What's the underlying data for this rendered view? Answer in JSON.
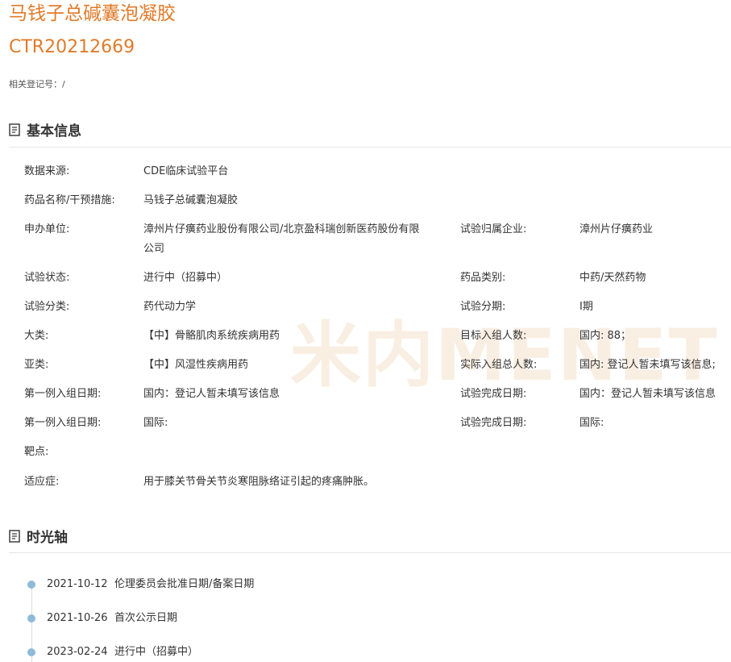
{
  "header": {
    "title": "马钱子总碱囊泡凝胶",
    "code": "CTR20212669",
    "related": "相关登记号：/"
  },
  "sections": {
    "basic": "基本信息",
    "timeline": "时光轴"
  },
  "watermark": "米内MENET",
  "info": {
    "source_label": "数据来源:",
    "source_value": "CDE临床试验平台",
    "drug_label": "药品名称/干预措施:",
    "drug_value": "马钱子总碱囊泡凝胶",
    "sponsor_label": "申办单位:",
    "sponsor_value": "漳州片仔癀药业股份有限公司/北京盈科瑞创新医药股份有限公司",
    "company_label": "试验归属企业:",
    "company_value": "漳州片仔癀药业",
    "status_label": "试验状态:",
    "status_value": "进行中（招募中）",
    "category_label": "药品类别:",
    "category_value": "中药/天然药物",
    "trial_type_label": "试验分类:",
    "trial_type_value": "药代动力学",
    "phase_label": "试验分期:",
    "phase_value": "I期",
    "major_label": "大类:",
    "major_value": "【中】骨骼肌肉系统疾病用药",
    "target_label": "目标入组人数:",
    "target_value": "国内: 88；",
    "minor_label": "亚类:",
    "minor_value": "【中】风湿性疾病用药",
    "actual_label": "实际入组总人数:",
    "actual_value": "国内: 登记人暂未填写该信息;",
    "first_dom_label": "第一例入组日期:",
    "first_dom_value": "国内：登记人暂未填写该信息",
    "complete_dom_label": "试验完成日期:",
    "complete_dom_value": "国内：登记人暂未填写该信息",
    "first_intl_label": "第一例入组日期:",
    "first_intl_value": "国际:",
    "complete_intl_label": "试验完成日期:",
    "complete_intl_value": "国际:",
    "target_point_label": "靶点:",
    "indication_label": "适应症:",
    "indication_value": "用于膝关节骨关节炎寒阻脉络证引起的疼痛肿胀。"
  },
  "timeline": [
    {
      "date": "2021-10-12",
      "event": "伦理委员会批准日期/备案日期"
    },
    {
      "date": "2021-10-26",
      "event": "首次公示日期"
    },
    {
      "date": "2023-02-24",
      "event": "进行中（招募中）"
    }
  ],
  "colors": {
    "accent": "#e07b2a",
    "timeline_dot": "#8fbad9",
    "watermark": "#f6e3cf"
  }
}
